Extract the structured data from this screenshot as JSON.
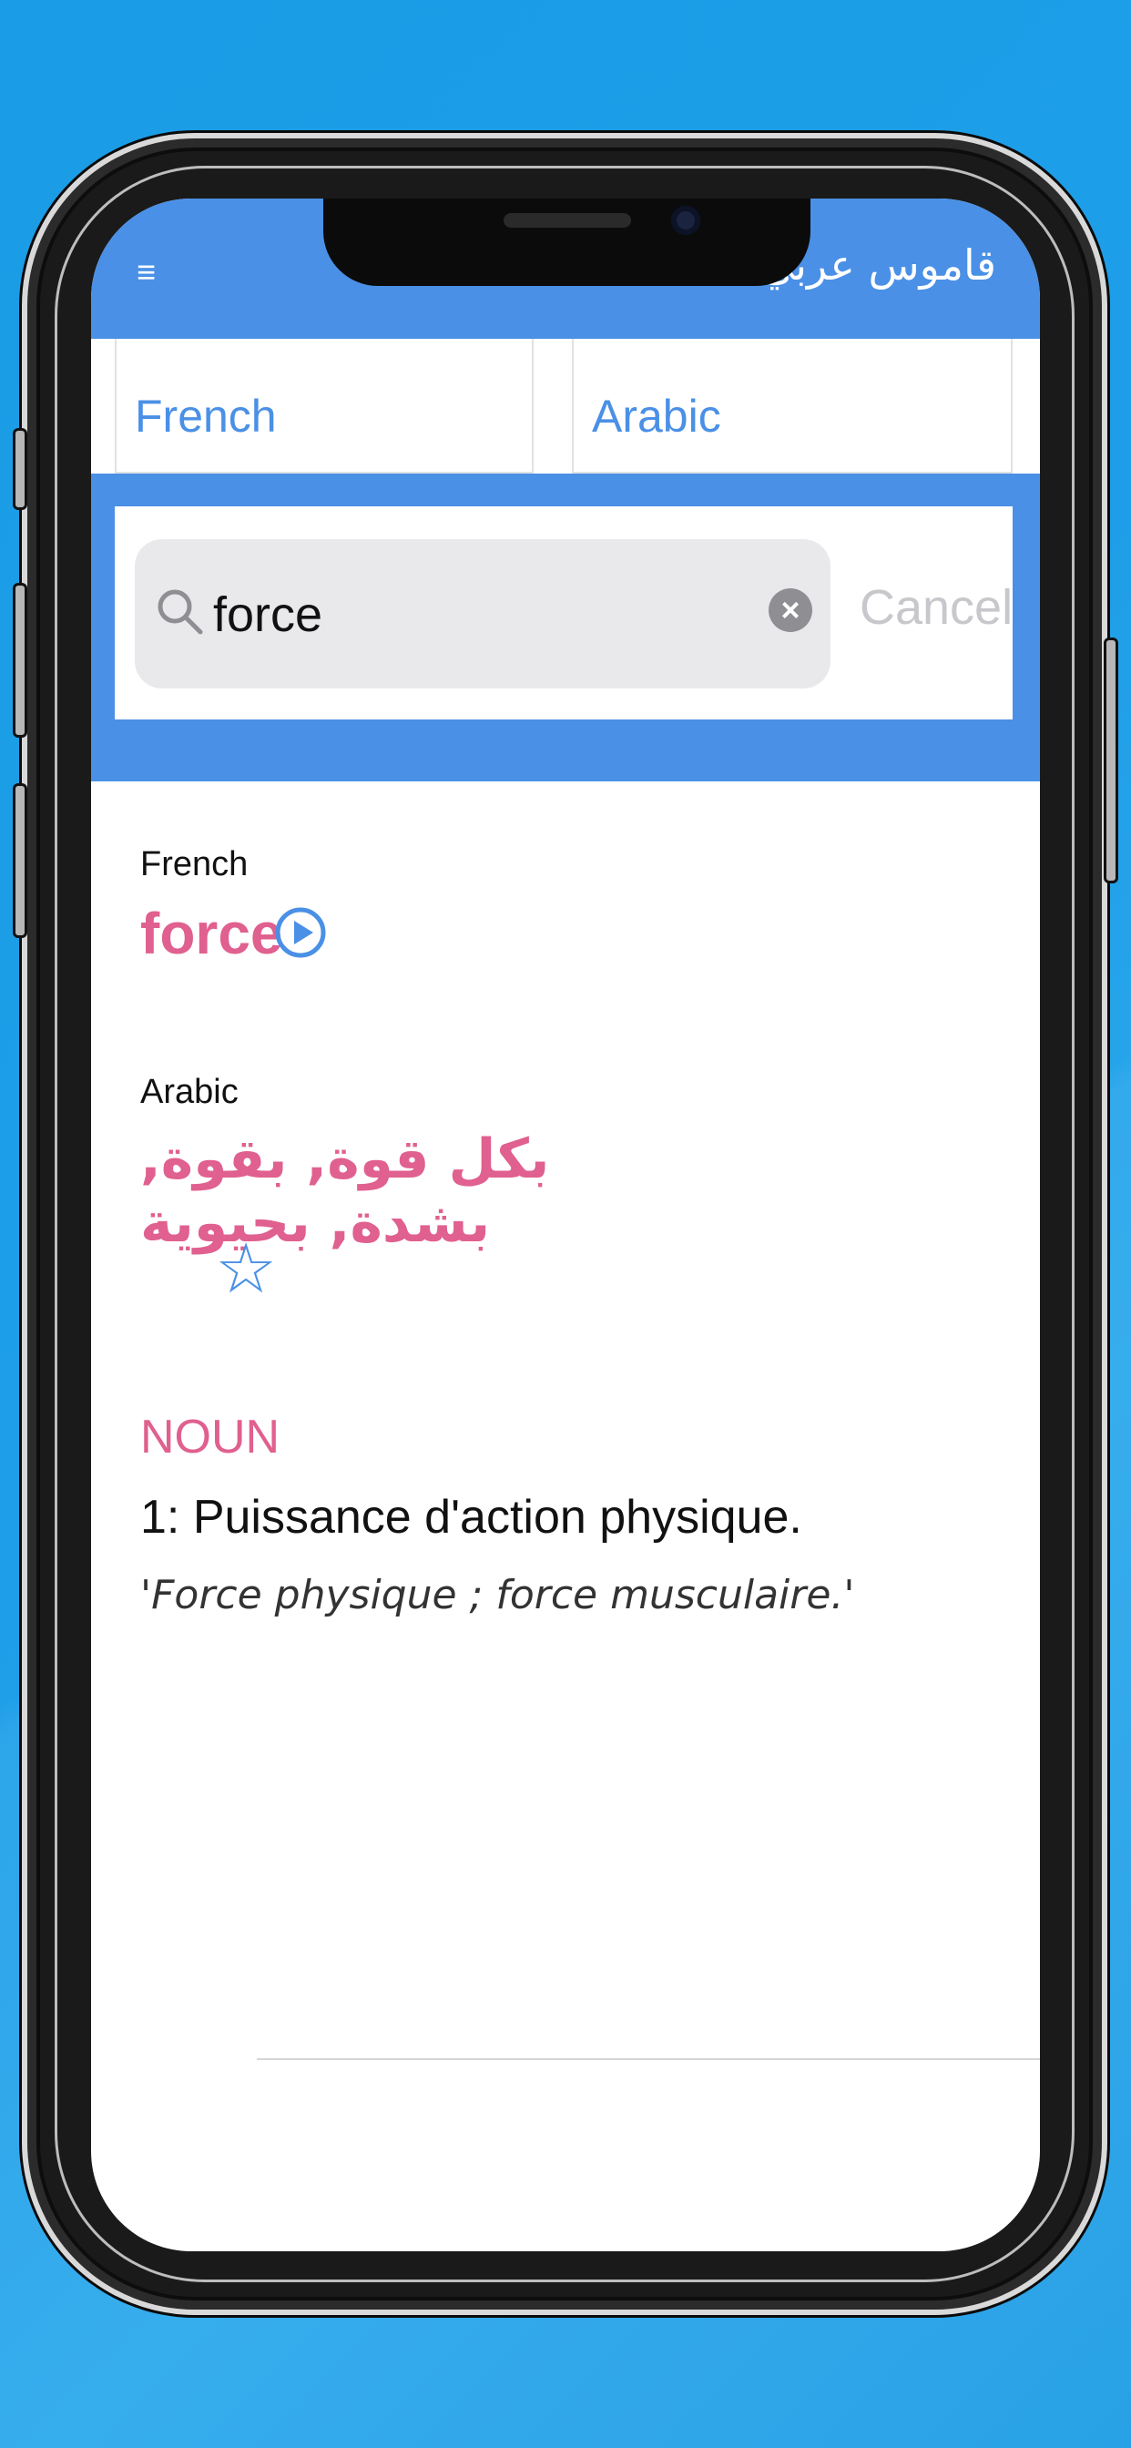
{
  "header": {
    "title": "قاموس عربي",
    "menu_icon": "hamburger-menu-icon"
  },
  "language_tabs": {
    "source": "French",
    "target": "Arabic"
  },
  "search": {
    "value": "force",
    "cancel_label": "Cancel",
    "search_icon": "magnifier-icon",
    "clear_icon": "clear-x-icon"
  },
  "result": {
    "source_label": "French",
    "term": "force",
    "target_label": "Arabic",
    "translation": "بكل قوة, بقوة, بشدة, بحيوية",
    "pos": "NOUN",
    "definition": "1:  Puissance d'action physique.",
    "example": "'Force physique ; force musculaire.'"
  },
  "colors": {
    "accent": "#4a90e6",
    "highlight": "#e0608f",
    "background": "#1e9ee8"
  }
}
